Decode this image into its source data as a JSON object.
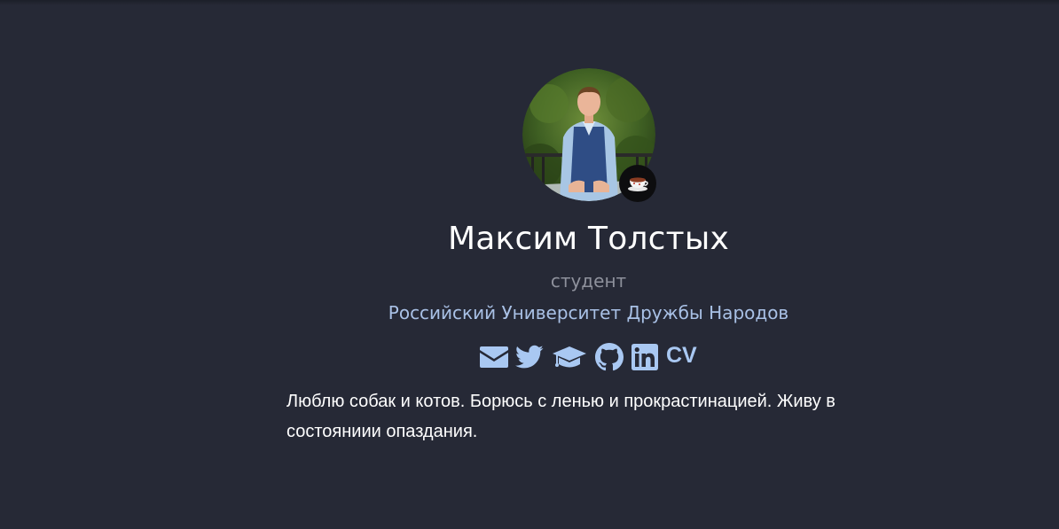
{
  "profile": {
    "avatar_icon": "person-photo",
    "status_icon": "teacup-icon",
    "name": "Максим Толстых",
    "role": "студент",
    "organization": "Российский Университет Дружбы Народов",
    "bio": "Люблю собак и котов. Борюсь с ленью и прокрастинацией. Живу в состояниии опаздания."
  },
  "social": {
    "icons": [
      "envelope-icon",
      "twitter-icon",
      "graduation-cap-icon",
      "github-icon",
      "linkedin-icon"
    ],
    "cv_label": "CV"
  },
  "colors": {
    "background": "#262936",
    "link": "#a9c8f2",
    "muted": "#8e919c",
    "text": "#ffffff"
  }
}
